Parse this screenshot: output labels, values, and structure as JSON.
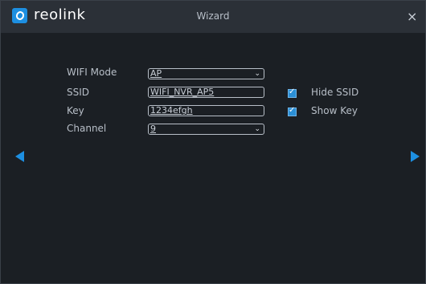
{
  "app": {
    "brand": "reolink",
    "title": "Wizard",
    "close_glyph": "×"
  },
  "form": {
    "wifi_mode": {
      "label": "WIFI Mode",
      "value": "AP"
    },
    "ssid": {
      "label": "SSID",
      "value": "WIFI_NVR_AP5"
    },
    "key": {
      "label": "Key",
      "value": "1234efgh"
    },
    "channel": {
      "label": "Channel",
      "value": "9"
    }
  },
  "options": {
    "hide_ssid": {
      "label": "Hide SSID",
      "checked": true
    },
    "show_key": {
      "label": "Show Key",
      "checked": true
    }
  },
  "icons": {
    "prev": "triangle-left-icon",
    "next": "triangle-right-icon",
    "dropdown": "chevron-down-icon",
    "check": "checkmark-icon"
  },
  "colors": {
    "accent": "#1d8fe1",
    "background": "#1b1f24",
    "titlebar": "#2b3037"
  }
}
